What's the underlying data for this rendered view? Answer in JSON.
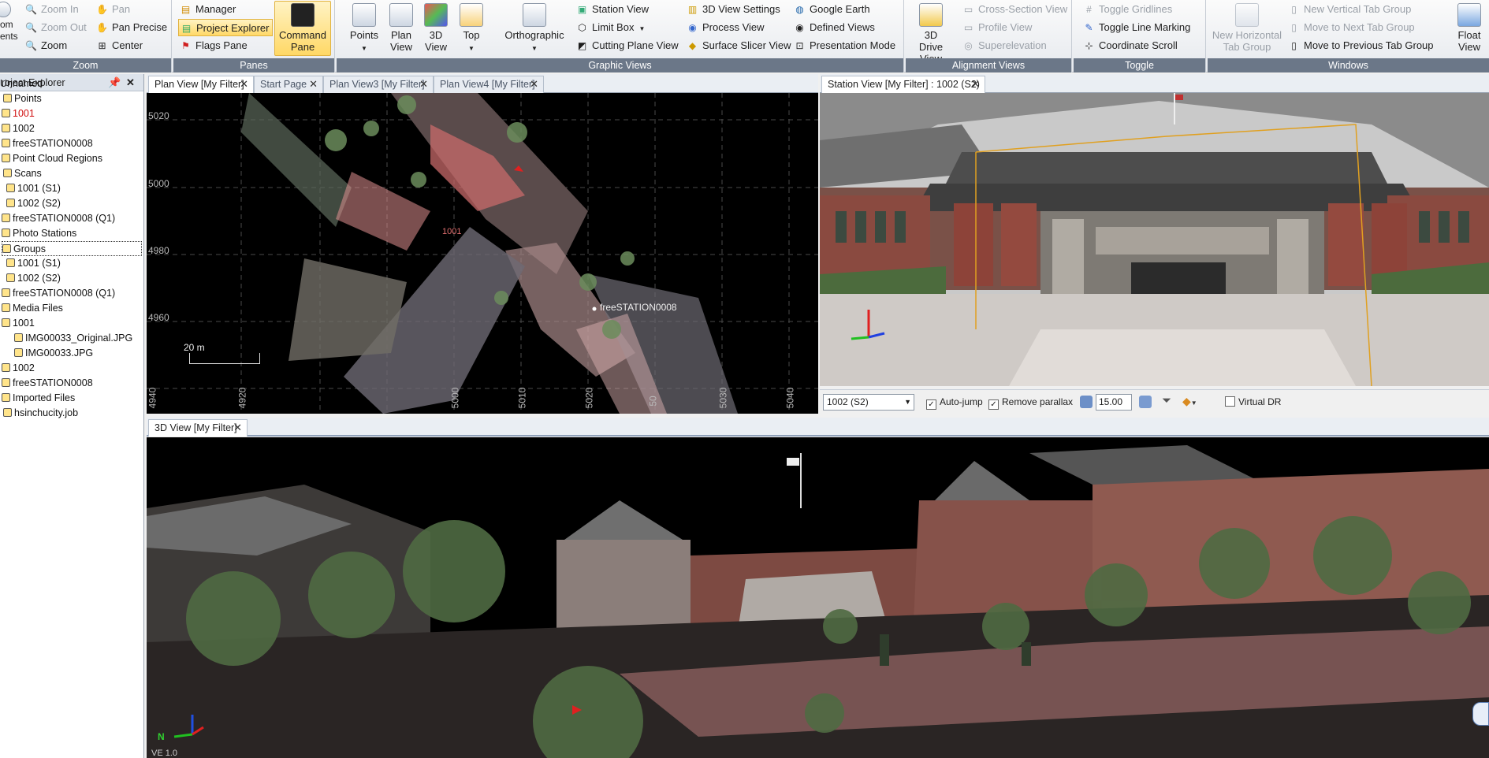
{
  "ribbon": {
    "zoom": {
      "label": "Zoom",
      "zoom_in": "Zoom In",
      "zoom_out": "Zoom Out",
      "zoom": "Zoom",
      "pan": "Pan",
      "pan_precise": "Pan Precise",
      "center": "Center",
      "zoom_to_extents": "om ents"
    },
    "panes": {
      "label": "Panes",
      "manager": "Manager",
      "project_explorer": "Project Explorer",
      "flags_pane": "Flags Pane",
      "command_pane": "Command Pane"
    },
    "graphic_views": {
      "label": "Graphic Views",
      "points": "Points",
      "plan_view": "Plan View",
      "view_3d": "3D View",
      "top": "Top",
      "orthographic": "Orthographic",
      "station_view": "Station View",
      "limit_box": "Limit Box",
      "cutting_plane_view": "Cutting Plane View",
      "view_3d_settings": "3D View Settings",
      "process_view": "Process View",
      "surface_slicer_view": "Surface Slicer View",
      "google_earth": "Google Earth",
      "defined_views": "Defined Views",
      "presentation_mode": "Presentation Mode"
    },
    "alignment_views": {
      "label": "Alignment Views",
      "drive_3d": "3D Drive View",
      "cross_section": "Cross-Section View",
      "profile_view": "Profile View",
      "superelevation": "Superelevation"
    },
    "toggle": {
      "label": "Toggle",
      "gridlines": "Toggle Gridlines",
      "line_marking": "Toggle Line Marking",
      "coordinate_scroll": "Coordinate Scroll"
    },
    "windows": {
      "label": "Windows",
      "new_horizontal": "New Horizontal Tab Group",
      "new_vertical": "New Vertical Tab Group",
      "move_next": "Move to Next Tab Group",
      "move_previous": "Move to Previous Tab Group",
      "float_view": "Float View"
    }
  },
  "explorer": {
    "title": "roject Explorer",
    "items": [
      "Unnamed",
      "Points",
      "1001",
      "1002",
      "freeSTATION0008",
      "Point Cloud Regions",
      "Scans",
      "1001 (S1)",
      "1002 (S2)",
      "freeSTATION0008 (Q1)",
      "Photo Stations",
      "Groups",
      "1001 (S1)",
      "1002 (S2)",
      "freeSTATION0008 (Q1)",
      "Media Files",
      "1001",
      "IMG00033_Original.JPG",
      "IMG00033.JPG",
      "1002",
      "freeSTATION0008",
      "Imported Files",
      "hsinchucity.job"
    ]
  },
  "plan": {
    "tabs": [
      "Plan View [My Filter]",
      "Start Page",
      "Plan View3 [My Filter]",
      "Plan View4 [My Filter]"
    ],
    "y_ticks": [
      "5020",
      "5000",
      "4980",
      "4960",
      "4940"
    ],
    "x_ticks": [
      "4920",
      "5000",
      "5010",
      "5020",
      "50",
      "5030",
      "5040"
    ],
    "scale": "20 m",
    "point_label_1": "1001",
    "point_label_2": "freeSTATION0008"
  },
  "station": {
    "tab": "Station View [My Filter] : 1002 (S2)",
    "station_select": "1002 (S2)",
    "auto_jump": "Auto-jump",
    "remove_parallax": "Remove parallax",
    "fov_value": "15.00",
    "virtual_dr": "Virtual DR"
  },
  "view3d": {
    "tab": "3D View [My Filter]",
    "axis_n": "N",
    "scale_text": "VE 1.0"
  },
  "colors": {
    "ribbon_label_bg": "#6b7788",
    "active_yellow": "#ffd866",
    "selection": "#1f5fbf"
  }
}
